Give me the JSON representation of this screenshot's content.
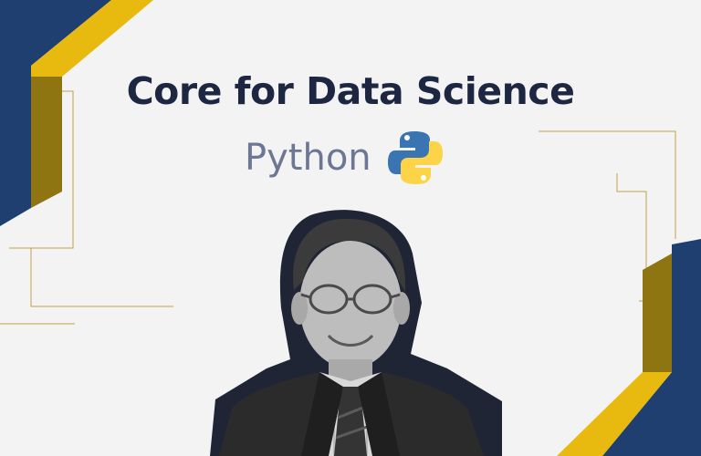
{
  "banner": {
    "title": "Core for Data Science",
    "subtitle": "Python",
    "logo_icon": "python-logo-icon",
    "portrait": "instructor-portrait-photo"
  },
  "colors": {
    "background": "#f3f3f3",
    "navy": "#1e3f6f",
    "gold": "#e8b90f",
    "dark_gold": "#8f7412",
    "line_gold": "#c4a24a",
    "title": "#1d2742",
    "subtitle": "#6d7794",
    "python_blue": "#3a74b2",
    "python_yellow": "#fdd448"
  }
}
